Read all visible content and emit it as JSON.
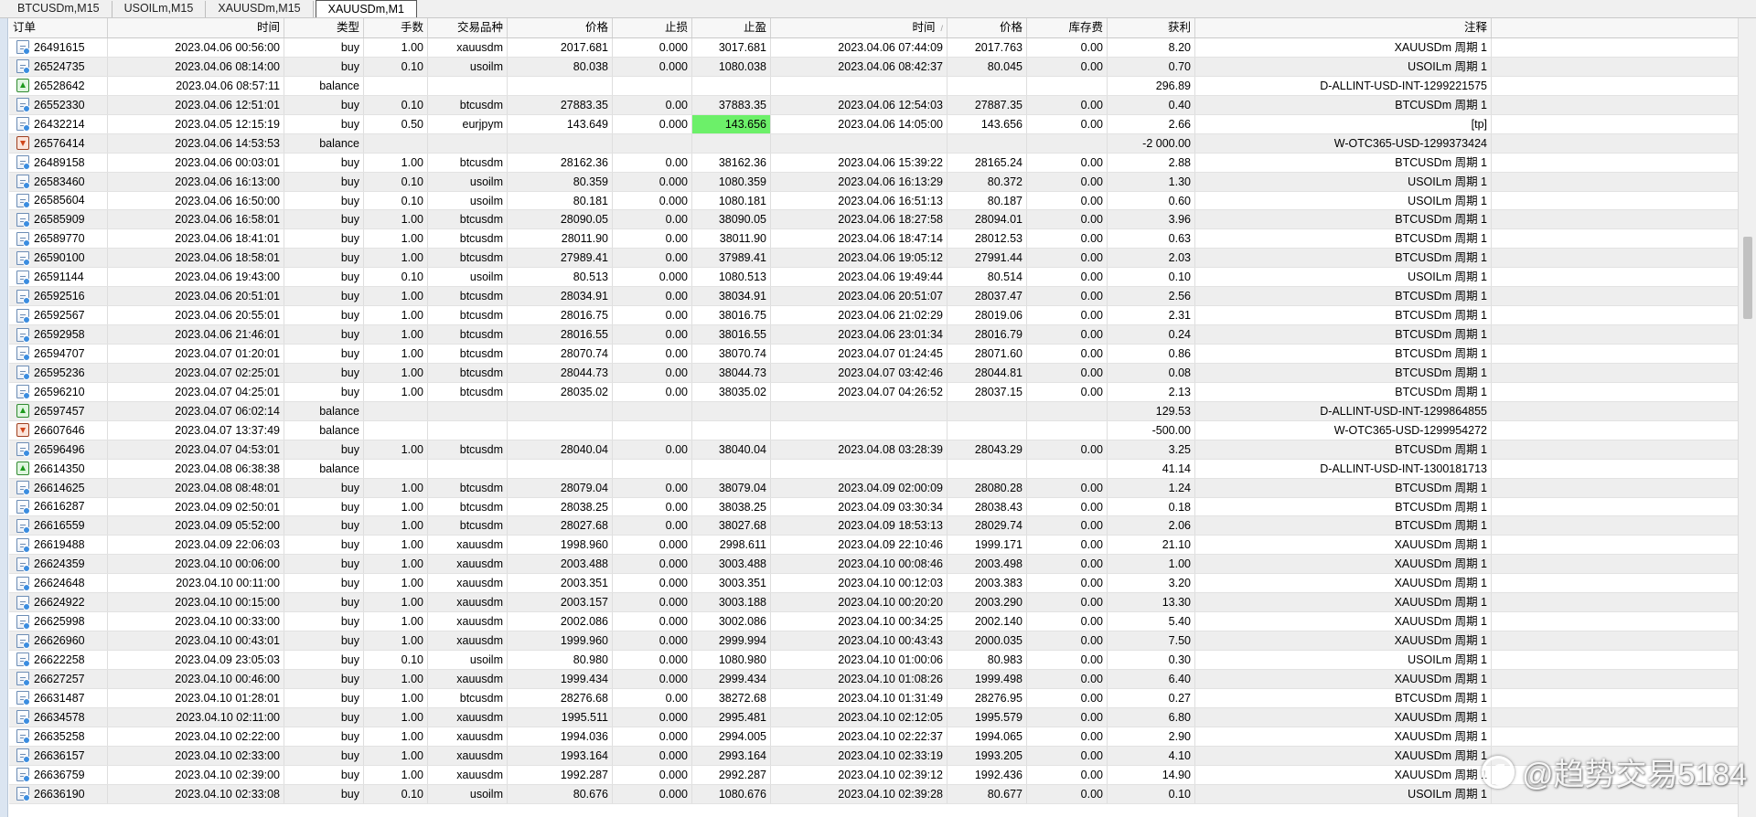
{
  "tabs": [
    "BTCUSDm,M15",
    "USOILm,M15",
    "XAUUSDm,M15",
    "XAUUSDm,M1"
  ],
  "active_tab": 3,
  "columns": [
    "订单",
    "时间",
    "类型",
    "手数",
    "交易品种",
    "价格",
    "止损",
    "止盈",
    "时间",
    "价格",
    "库存费",
    "获利",
    "注释"
  ],
  "sort_indicator": "/",
  "highlight_color": "#6cf069",
  "rows": [
    [
      "trade",
      "26491615",
      "2023.04.06 00:56:00",
      "buy",
      "1.00",
      "xauusdm",
      "2017.681",
      "0.000",
      "3017.681",
      "2023.04.06 07:44:09",
      "2017.763",
      "0.00",
      "8.20",
      "XAUUSDm 周期 1"
    ],
    [
      "trade",
      "26524735",
      "2023.04.06 08:14:00",
      "buy",
      "0.10",
      "usoilm",
      "80.038",
      "0.000",
      "1080.038",
      "2023.04.06 08:42:37",
      "80.045",
      "0.00",
      "0.70",
      "USOILm 周期 1"
    ],
    [
      "bal-in",
      "26528642",
      "2023.04.06 08:57:11",
      "balance",
      "",
      "",
      "",
      "",
      "",
      "",
      "",
      "",
      "296.89",
      "D-ALLINT-USD-INT-1299221575"
    ],
    [
      "trade",
      "26552330",
      "2023.04.06 12:51:01",
      "buy",
      "0.10",
      "btcusdm",
      "27883.35",
      "0.00",
      "37883.35",
      "2023.04.06 12:54:03",
      "27887.35",
      "0.00",
      "0.40",
      "BTCUSDm 周期 1"
    ],
    [
      "trade",
      "26432214",
      "2023.04.05 12:15:19",
      "buy",
      "0.50",
      "eurjpym",
      "143.649",
      "0.000",
      "143.656",
      "2023.04.06 14:05:00",
      "143.656",
      "0.00",
      "2.66",
      "[tp]"
    ],
    [
      "bal-out",
      "26576414",
      "2023.04.06 14:53:53",
      "balance",
      "",
      "",
      "",
      "",
      "",
      "",
      "",
      "",
      "-2 000.00",
      "W-OTC365-USD-1299373424"
    ],
    [
      "trade",
      "26489158",
      "2023.04.06 00:03:01",
      "buy",
      "1.00",
      "btcusdm",
      "28162.36",
      "0.00",
      "38162.36",
      "2023.04.06 15:39:22",
      "28165.24",
      "0.00",
      "2.88",
      "BTCUSDm 周期 1"
    ],
    [
      "trade",
      "26583460",
      "2023.04.06 16:13:00",
      "buy",
      "0.10",
      "usoilm",
      "80.359",
      "0.000",
      "1080.359",
      "2023.04.06 16:13:29",
      "80.372",
      "0.00",
      "1.30",
      "USOILm 周期 1"
    ],
    [
      "trade",
      "26585604",
      "2023.04.06 16:50:00",
      "buy",
      "0.10",
      "usoilm",
      "80.181",
      "0.000",
      "1080.181",
      "2023.04.06 16:51:13",
      "80.187",
      "0.00",
      "0.60",
      "USOILm 周期 1"
    ],
    [
      "trade",
      "26585909",
      "2023.04.06 16:58:01",
      "buy",
      "1.00",
      "btcusdm",
      "28090.05",
      "0.00",
      "38090.05",
      "2023.04.06 18:27:58",
      "28094.01",
      "0.00",
      "3.96",
      "BTCUSDm 周期 1"
    ],
    [
      "trade",
      "26589770",
      "2023.04.06 18:41:01",
      "buy",
      "1.00",
      "btcusdm",
      "28011.90",
      "0.00",
      "38011.90",
      "2023.04.06 18:47:14",
      "28012.53",
      "0.00",
      "0.63",
      "BTCUSDm 周期 1"
    ],
    [
      "trade",
      "26590100",
      "2023.04.06 18:58:01",
      "buy",
      "1.00",
      "btcusdm",
      "27989.41",
      "0.00",
      "37989.41",
      "2023.04.06 19:05:12",
      "27991.44",
      "0.00",
      "2.03",
      "BTCUSDm 周期 1"
    ],
    [
      "trade",
      "26591144",
      "2023.04.06 19:43:00",
      "buy",
      "0.10",
      "usoilm",
      "80.513",
      "0.000",
      "1080.513",
      "2023.04.06 19:49:44",
      "80.514",
      "0.00",
      "0.10",
      "USOILm 周期 1"
    ],
    [
      "trade",
      "26592516",
      "2023.04.06 20:51:01",
      "buy",
      "1.00",
      "btcusdm",
      "28034.91",
      "0.00",
      "38034.91",
      "2023.04.06 20:51:07",
      "28037.47",
      "0.00",
      "2.56",
      "BTCUSDm 周期 1"
    ],
    [
      "trade",
      "26592567",
      "2023.04.06 20:55:01",
      "buy",
      "1.00",
      "btcusdm",
      "28016.75",
      "0.00",
      "38016.75",
      "2023.04.06 21:02:29",
      "28019.06",
      "0.00",
      "2.31",
      "BTCUSDm 周期 1"
    ],
    [
      "trade",
      "26592958",
      "2023.04.06 21:46:01",
      "buy",
      "1.00",
      "btcusdm",
      "28016.55",
      "0.00",
      "38016.55",
      "2023.04.06 23:01:34",
      "28016.79",
      "0.00",
      "0.24",
      "BTCUSDm 周期 1"
    ],
    [
      "trade",
      "26594707",
      "2023.04.07 01:20:01",
      "buy",
      "1.00",
      "btcusdm",
      "28070.74",
      "0.00",
      "38070.74",
      "2023.04.07 01:24:45",
      "28071.60",
      "0.00",
      "0.86",
      "BTCUSDm 周期 1"
    ],
    [
      "trade",
      "26595236",
      "2023.04.07 02:25:01",
      "buy",
      "1.00",
      "btcusdm",
      "28044.73",
      "0.00",
      "38044.73",
      "2023.04.07 03:42:46",
      "28044.81",
      "0.00",
      "0.08",
      "BTCUSDm 周期 1"
    ],
    [
      "trade",
      "26596210",
      "2023.04.07 04:25:01",
      "buy",
      "1.00",
      "btcusdm",
      "28035.02",
      "0.00",
      "38035.02",
      "2023.04.07 04:26:52",
      "28037.15",
      "0.00",
      "2.13",
      "BTCUSDm 周期 1"
    ],
    [
      "bal-in",
      "26597457",
      "2023.04.07 06:02:14",
      "balance",
      "",
      "",
      "",
      "",
      "",
      "",
      "",
      "",
      "129.53",
      "D-ALLINT-USD-INT-1299864855"
    ],
    [
      "bal-out",
      "26607646",
      "2023.04.07 13:37:49",
      "balance",
      "",
      "",
      "",
      "",
      "",
      "",
      "",
      "",
      "-500.00",
      "W-OTC365-USD-1299954272"
    ],
    [
      "trade",
      "26596496",
      "2023.04.07 04:53:01",
      "buy",
      "1.00",
      "btcusdm",
      "28040.04",
      "0.00",
      "38040.04",
      "2023.04.08 03:28:39",
      "28043.29",
      "0.00",
      "3.25",
      "BTCUSDm 周期 1"
    ],
    [
      "bal-in",
      "26614350",
      "2023.04.08 06:38:38",
      "balance",
      "",
      "",
      "",
      "",
      "",
      "",
      "",
      "",
      "41.14",
      "D-ALLINT-USD-INT-1300181713"
    ],
    [
      "trade",
      "26614625",
      "2023.04.08 08:48:01",
      "buy",
      "1.00",
      "btcusdm",
      "28079.04",
      "0.00",
      "38079.04",
      "2023.04.09 02:00:09",
      "28080.28",
      "0.00",
      "1.24",
      "BTCUSDm 周期 1"
    ],
    [
      "trade",
      "26616287",
      "2023.04.09 02:50:01",
      "buy",
      "1.00",
      "btcusdm",
      "28038.25",
      "0.00",
      "38038.25",
      "2023.04.09 03:30:34",
      "28038.43",
      "0.00",
      "0.18",
      "BTCUSDm 周期 1"
    ],
    [
      "trade",
      "26616559",
      "2023.04.09 05:52:00",
      "buy",
      "1.00",
      "btcusdm",
      "28027.68",
      "0.00",
      "38027.68",
      "2023.04.09 18:53:13",
      "28029.74",
      "0.00",
      "2.06",
      "BTCUSDm 周期 1"
    ],
    [
      "trade",
      "26619488",
      "2023.04.09 22:06:03",
      "buy",
      "1.00",
      "xauusdm",
      "1998.960",
      "0.000",
      "2998.611",
      "2023.04.09 22:10:46",
      "1999.171",
      "0.00",
      "21.10",
      "XAUUSDm 周期 1"
    ],
    [
      "trade",
      "26624359",
      "2023.04.10 00:06:00",
      "buy",
      "1.00",
      "xauusdm",
      "2003.488",
      "0.000",
      "3003.488",
      "2023.04.10 00:08:46",
      "2003.498",
      "0.00",
      "1.00",
      "XAUUSDm 周期 1"
    ],
    [
      "trade",
      "26624648",
      "2023.04.10 00:11:00",
      "buy",
      "1.00",
      "xauusdm",
      "2003.351",
      "0.000",
      "3003.351",
      "2023.04.10 00:12:03",
      "2003.383",
      "0.00",
      "3.20",
      "XAUUSDm 周期 1"
    ],
    [
      "trade",
      "26624922",
      "2023.04.10 00:15:00",
      "buy",
      "1.00",
      "xauusdm",
      "2003.157",
      "0.000",
      "3003.188",
      "2023.04.10 00:20:20",
      "2003.290",
      "0.00",
      "13.30",
      "XAUUSDm 周期 1"
    ],
    [
      "trade",
      "26625998",
      "2023.04.10 00:33:00",
      "buy",
      "1.00",
      "xauusdm",
      "2002.086",
      "0.000",
      "3002.086",
      "2023.04.10 00:34:25",
      "2002.140",
      "0.00",
      "5.40",
      "XAUUSDm 周期 1"
    ],
    [
      "trade",
      "26626960",
      "2023.04.10 00:43:01",
      "buy",
      "1.00",
      "xauusdm",
      "1999.960",
      "0.000",
      "2999.994",
      "2023.04.10 00:43:43",
      "2000.035",
      "0.00",
      "7.50",
      "XAUUSDm 周期 1"
    ],
    [
      "trade",
      "26622258",
      "2023.04.09 23:05:03",
      "buy",
      "0.10",
      "usoilm",
      "80.980",
      "0.000",
      "1080.980",
      "2023.04.10 01:00:06",
      "80.983",
      "0.00",
      "0.30",
      "USOILm 周期 1"
    ],
    [
      "trade",
      "26627257",
      "2023.04.10 00:46:00",
      "buy",
      "1.00",
      "xauusdm",
      "1999.434",
      "0.000",
      "2999.434",
      "2023.04.10 01:08:26",
      "1999.498",
      "0.00",
      "6.40",
      "XAUUSDm 周期 1"
    ],
    [
      "trade",
      "26631487",
      "2023.04.10 01:28:01",
      "buy",
      "1.00",
      "btcusdm",
      "28276.68",
      "0.00",
      "38272.68",
      "2023.04.10 01:31:49",
      "28276.95",
      "0.00",
      "0.27",
      "BTCUSDm 周期 1"
    ],
    [
      "trade",
      "26634578",
      "2023.04.10 02:11:00",
      "buy",
      "1.00",
      "xauusdm",
      "1995.511",
      "0.000",
      "2995.481",
      "2023.04.10 02:12:05",
      "1995.579",
      "0.00",
      "6.80",
      "XAUUSDm 周期 1"
    ],
    [
      "trade",
      "26635258",
      "2023.04.10 02:22:00",
      "buy",
      "1.00",
      "xauusdm",
      "1994.036",
      "0.000",
      "2994.005",
      "2023.04.10 02:22:37",
      "1994.065",
      "0.00",
      "2.90",
      "XAUUSDm 周期 1"
    ],
    [
      "trade",
      "26636157",
      "2023.04.10 02:33:00",
      "buy",
      "1.00",
      "xauusdm",
      "1993.164",
      "0.000",
      "2993.164",
      "2023.04.10 02:33:19",
      "1993.205",
      "0.00",
      "4.10",
      "XAUUSDm 周期 1"
    ],
    [
      "trade",
      "26636759",
      "2023.04.10 02:39:00",
      "buy",
      "1.00",
      "xauusdm",
      "1992.287",
      "0.000",
      "2992.287",
      "2023.04.10 02:39:12",
      "1992.436",
      "0.00",
      "14.90",
      "XAUUSDm 周期 1"
    ],
    [
      "trade",
      "26636190",
      "2023.04.10 02:33:08",
      "buy",
      "0.10",
      "usoilm",
      "80.676",
      "0.000",
      "1080.676",
      "2023.04.10 02:39:28",
      "80.677",
      "0.00",
      "0.10",
      "USOILm 周期 1"
    ]
  ],
  "highlighted_cell": {
    "row": 4,
    "column": 7
  },
  "watermark": "@趋势交易5184"
}
